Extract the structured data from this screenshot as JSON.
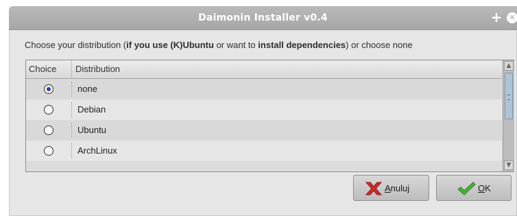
{
  "window": {
    "title": "Daimonin Installer v0.4"
  },
  "titlebar": {
    "plus_glyph": "+",
    "close_glyph": "✕"
  },
  "prompt": {
    "segments": [
      {
        "text": "Choose your distribution (",
        "bold": false
      },
      {
        "text": "if you use (K)Ubuntu",
        "bold": true
      },
      {
        "text": " or want to ",
        "bold": false
      },
      {
        "text": "install dependencies",
        "bold": true
      },
      {
        "text": ") or choose none",
        "bold": false
      }
    ]
  },
  "table": {
    "columns": [
      "Choice",
      "Distribution"
    ],
    "rows": [
      {
        "distribution": "none",
        "selected": true
      },
      {
        "distribution": "Debian",
        "selected": false
      },
      {
        "distribution": "Ubuntu",
        "selected": false
      },
      {
        "distribution": "ArchLinux",
        "selected": false
      }
    ]
  },
  "buttons": {
    "cancel": {
      "mnemonic": "A",
      "rest": "nuluj",
      "icon": "red-x-icon"
    },
    "ok": {
      "mnemonic": "O",
      "rest": "K",
      "icon": "green-check-icon"
    }
  },
  "colors": {
    "titlebar": "#a9a9a9",
    "selected_radio": "#2f3eae",
    "scroll_thumb": "#b0c4d6",
    "cancel_icon": "#d02b2b",
    "ok_icon": "#49b43a"
  }
}
